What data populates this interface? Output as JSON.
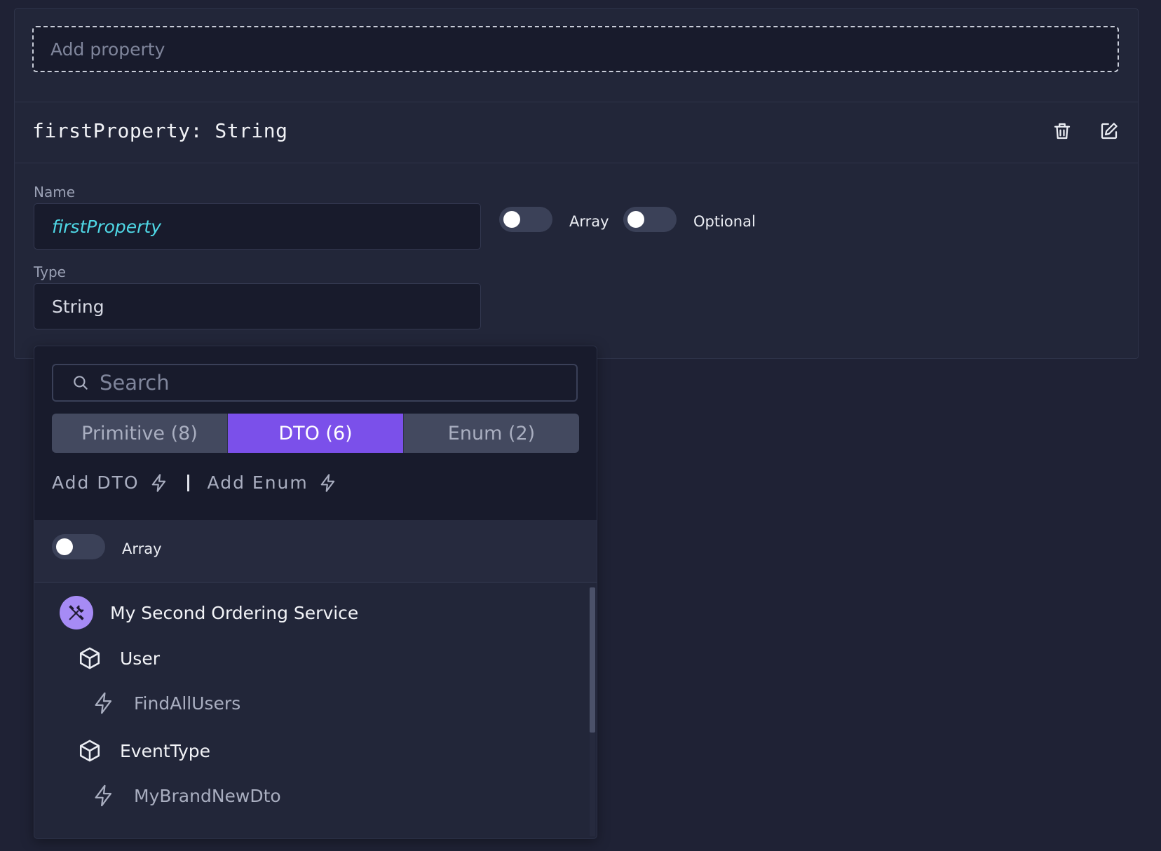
{
  "editor": {
    "add_property_placeholder": "Add property",
    "property_title": "firstProperty: String",
    "name_label": "Name",
    "name_value": "firstProperty",
    "type_label": "Type",
    "type_value": "String",
    "array_label": "Array",
    "array_on": false,
    "optional_label": "Optional",
    "optional_on": false,
    "delete_icon": "trash-icon",
    "edit_icon": "edit-icon"
  },
  "type_picker": {
    "search_placeholder": "Search",
    "tabs": [
      {
        "label": "Primitive (8)",
        "active": false
      },
      {
        "label": "DTO (6)",
        "active": true
      },
      {
        "label": "Enum (2)",
        "active": false
      }
    ],
    "add_dto_label": "Add DTO",
    "add_enum_label": "Add Enum",
    "array_label": "Array",
    "array_on": false,
    "tree": {
      "service": {
        "label": "My Second Ordering Service",
        "icon": "tools-icon"
      },
      "items": [
        {
          "kind": "dto",
          "label": "User",
          "icon": "cube-icon"
        },
        {
          "kind": "endpoint",
          "label": "FindAllUsers",
          "icon": "bolt-icon"
        },
        {
          "kind": "dto",
          "label": "EventType",
          "icon": "cube-icon"
        },
        {
          "kind": "endpoint",
          "label": "MyBrandNewDto",
          "icon": "bolt-icon"
        }
      ]
    }
  },
  "colors": {
    "accent": "#7b50ea",
    "service_badge": "#a68bf5",
    "name_value": "#4fd8e6",
    "background": "#1f2235"
  }
}
